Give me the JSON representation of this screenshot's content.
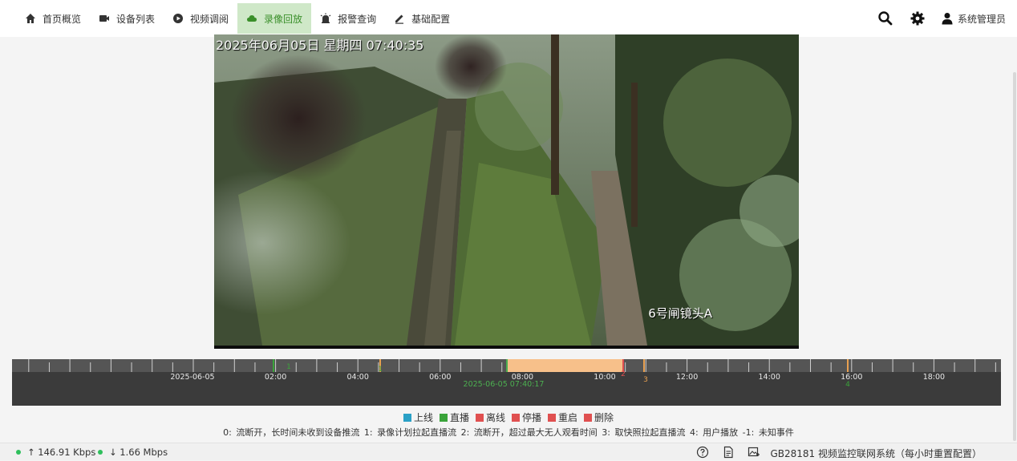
{
  "nav": {
    "items": [
      {
        "label": "首页概览",
        "icon": "home-icon",
        "active": false
      },
      {
        "label": "设备列表",
        "icon": "video-camera-icon",
        "active": false
      },
      {
        "label": "视频调阅",
        "icon": "play-circle-icon",
        "active": false
      },
      {
        "label": "录像回放",
        "icon": "cloud-icon",
        "active": true
      },
      {
        "label": "报警查询",
        "icon": "alarm-icon",
        "active": false
      },
      {
        "label": "基础配置",
        "icon": "edit-icon",
        "active": false
      }
    ]
  },
  "toolbar": {
    "user_label": "系统管理员"
  },
  "video": {
    "osd_time": "2025年06月05日  星期四  07:40:35",
    "osd_camera": "6号闸镜头A"
  },
  "timeline": {
    "date_label": "2025-06-05",
    "hour_labels": [
      "02:00",
      "04:00",
      "06:00",
      "08:00",
      "10:00",
      "12:00",
      "14:00",
      "16:00",
      "18:00"
    ],
    "cursor_label": "2025-06-05 07:40:17",
    "event_markers": [
      "1",
      "1",
      "2",
      "3",
      "4"
    ],
    "colors": {
      "recording": "#f7c08a",
      "cursor": "#4caf50"
    }
  },
  "legend": {
    "items": [
      {
        "label": "上线",
        "color": "#2aa0c6"
      },
      {
        "label": "直播",
        "color": "#3aa33a"
      },
      {
        "label": "离线",
        "color": "#e05050"
      },
      {
        "label": "停播",
        "color": "#e05050"
      },
      {
        "label": "重启",
        "color": "#e05050"
      },
      {
        "label": "删除",
        "color": "#e05050"
      }
    ]
  },
  "codes": "0: 流断开，长时间未收到设备推流   1: 录像计划拉起直播流   2: 流断开，超过最大无人观看时间   3: 取快照拉起直播流   4: 用户播放   -1: 未知事件",
  "statusbar": {
    "upload": "↑ 146.91 Kbps",
    "download": "↓ 1.66 Mbps",
    "system_name": "GB28181 视频监控联网系统（每小时重置配置）"
  }
}
